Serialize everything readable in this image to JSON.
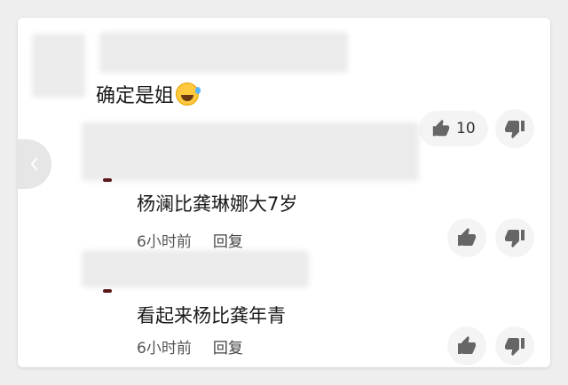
{
  "comments": [
    {
      "text": "确定是姐",
      "likes": "10"
    },
    {
      "text": "杨澜比龚琳娜大7岁",
      "time": "6小时前",
      "reply_label": "回复"
    },
    {
      "text": "看起来杨比龚年青",
      "time": "6小时前",
      "reply_label": "回复"
    }
  ],
  "icons": {
    "like": "thumbs-up-icon",
    "dislike": "thumbs-down-icon",
    "back": "chevron-left-icon",
    "emoji": "rolling-laughing-emoji"
  },
  "colors": {
    "icon": "#666666",
    "background": "#ffffff",
    "text": "#1a1a1a"
  }
}
